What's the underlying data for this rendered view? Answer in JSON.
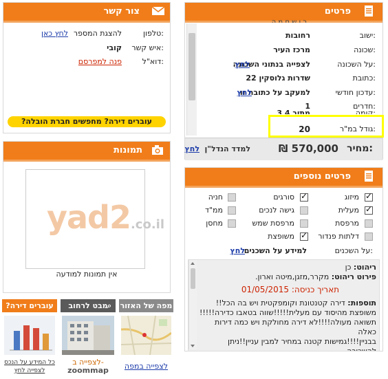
{
  "details": {
    "title": "פרטים",
    "partial_top": "ר ו ש ם מ ה",
    "rows": [
      {
        "label": "ישוב:",
        "value": "רחובות"
      },
      {
        "label": "שכונה:",
        "value": "מרכז העיר"
      },
      {
        "label": "על השכונה:",
        "value": "לצפייה בנתוני השכונה",
        "link": "לחץ"
      },
      {
        "label": "כתובת:",
        "value": "שדרות גלוסקין 22"
      },
      {
        "label": "עדכון חודשי:",
        "value": "למעקב על כתובת זו",
        "link": "לחץ"
      },
      {
        "label": "חדרים:",
        "value": "1"
      },
      {
        "label": "קומה:",
        "value": "3 מתוך 4"
      },
      {
        "label": "גודל במ\"ר:",
        "value": "20"
      }
    ],
    "price_label": "מחיר:",
    "price_value": "570,000 ₪",
    "index_text": "למדד הנדל\"ן",
    "index_link": "לחץ"
  },
  "contact": {
    "title": "צור קשר",
    "phone_label": "טלפון:",
    "phone_text": "להצגת המספר",
    "phone_link": "לחץ כאן",
    "person_label": "איש קשר:",
    "person_value": "קובי",
    "email_label": "דוא\"ל:",
    "email_link": "פנה למפרסם",
    "moving_banner": "עוברים דירה? מחפשים חברת הובלה?"
  },
  "extra": {
    "title": "פרטים נוספים",
    "features": [
      {
        "label": "מיזוג",
        "checked": true
      },
      {
        "label": "סורגים",
        "checked": true
      },
      {
        "label": "חניה",
        "checked": false
      },
      {
        "label": "מעלית",
        "checked": true
      },
      {
        "label": "גישה לנכים",
        "checked": false
      },
      {
        "label": "ממ\"ד",
        "checked": false
      },
      {
        "label": "מרפסת",
        "checked": false
      },
      {
        "label": "מרפסת שמש",
        "checked": false
      },
      {
        "label": "מחסן",
        "checked": false
      },
      {
        "label": "דלתות פנדור",
        "checked": false
      },
      {
        "label": "משופצת",
        "checked": true
      }
    ],
    "neighbors_label": "על השכנים:",
    "neighbors_text": "למידע על השכנים",
    "neighbors_link": "לחץ",
    "furniture_label": "ריהוט:",
    "furniture_value": "כן",
    "furniture_detail_label": "פירוט ריהוט:",
    "furniture_detail_value": "מקרר,מזגן,מיטה וארון.",
    "entry_label": "תאריך כניסה:",
    "entry_value": "01/05/2015",
    "additions_label": "תוספות:",
    "additions_lines": [
      "דירה קטנטונת וקומפקטית ויש בה הכל!!",
      "משופצת מהיסוד עם מעלית!!!!!שווה בטאבו כדירה!!!!!",
      "תשואה מעולה!!!!לא דירה מחולקת ויש כמה דירות כאלה",
      "בבניין!!!!גמישות קטנה במחיר למבין עניין!!ניתן להשכירה",
      "ב2300 ש\"ח"
    ]
  },
  "photos": {
    "title": "תמונות",
    "logo_main": "yad2",
    "logo_suffix": ".co.il",
    "no_photos": "אין תמונות למודעה"
  },
  "tiles": [
    {
      "title": "מפה של האזור",
      "link": "לצפייה במפה"
    },
    {
      "title": "מבט לרחוב",
      "link": "לצפייה ב-",
      "brand": "zoommap"
    },
    {
      "title": "עוברים דירה?",
      "line1": "כל המידע על הנכס",
      "line2": "לצפייה לחץ"
    }
  ],
  "colors": {
    "accent": "#f07d1a",
    "highlight": "#ffff00",
    "link": "#1a3aa8",
    "red": "#cc2200"
  }
}
